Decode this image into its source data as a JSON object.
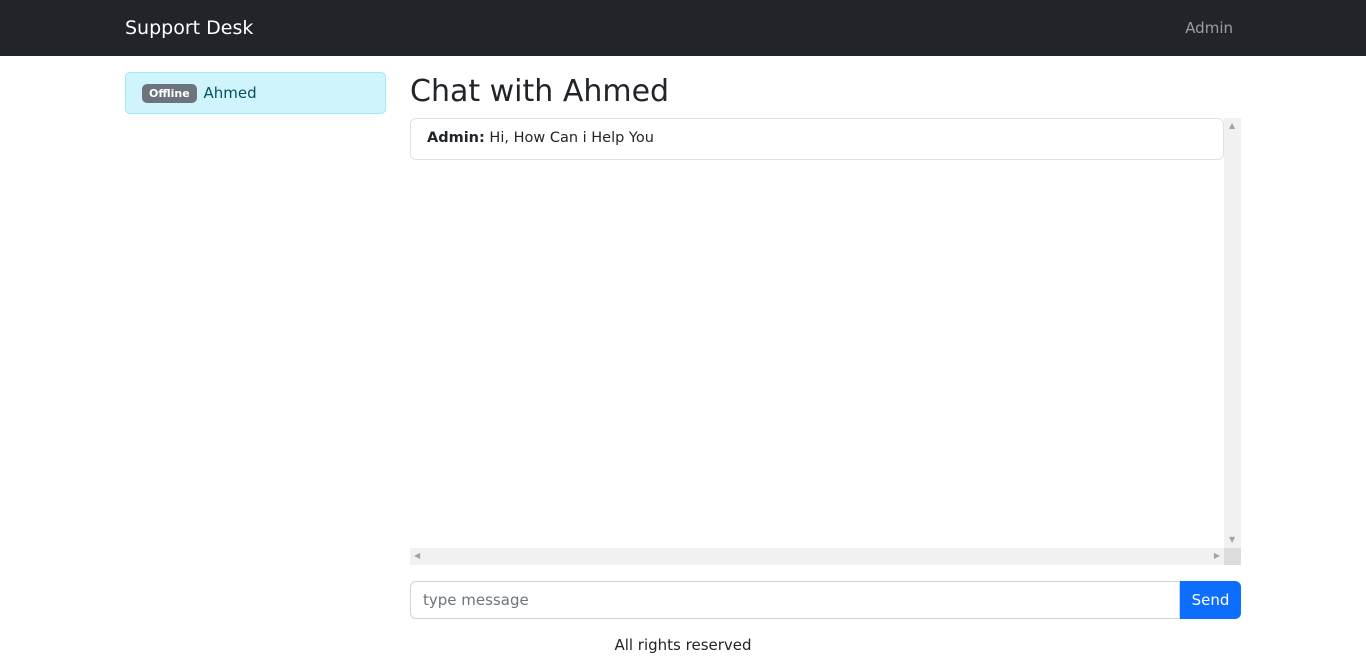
{
  "navbar": {
    "brand": "Support Desk",
    "user_link": "Admin"
  },
  "sidebar": {
    "users": [
      {
        "status": "Offline",
        "name": "Ahmed"
      }
    ]
  },
  "chat": {
    "title": "Chat with Ahmed",
    "messages": [
      {
        "sender": "Admin:",
        "text": "Hi, How Can i Help You"
      }
    ]
  },
  "composer": {
    "placeholder": "type message",
    "value": "",
    "send_label": "Send"
  },
  "footer": {
    "text": "All rights reserved"
  }
}
